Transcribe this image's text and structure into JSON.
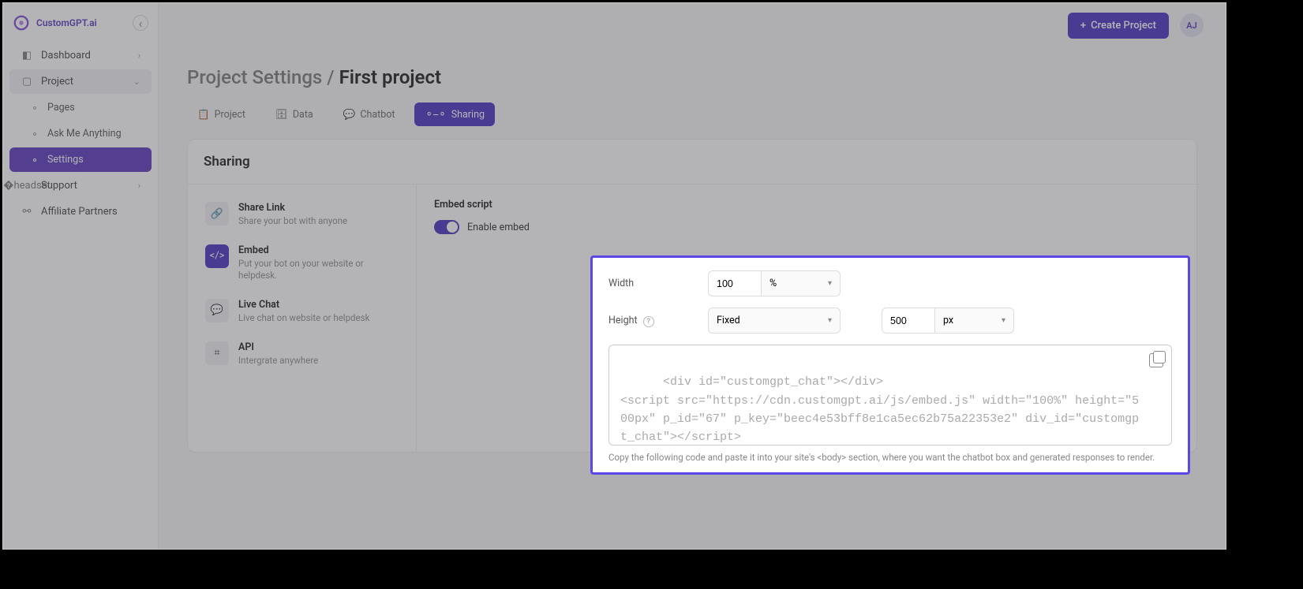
{
  "brand": "CustomGPT.ai",
  "sidebar": {
    "dashboard": "Dashboard",
    "project": "Project",
    "pages": "Pages",
    "ama": "Ask Me Anything",
    "settings": "Settings",
    "support": "Support",
    "affiliate": "Affiliate Partners"
  },
  "topbar": {
    "create": "Create Project",
    "avatar": "AJ"
  },
  "breadcrumb": {
    "parent": "Project Settings /",
    "current": "First project"
  },
  "tabs": {
    "project": "Project",
    "data": "Data",
    "chatbot": "Chatbot",
    "sharing": "Sharing"
  },
  "panel_title": "Sharing",
  "options": {
    "share_link": {
      "t": "Share Link",
      "d": "Share your bot with anyone"
    },
    "embed": {
      "t": "Embed",
      "d": "Put your bot on your website or helpdesk."
    },
    "live_chat": {
      "t": "Live Chat",
      "d": "Live chat on website or helpdesk"
    },
    "api": {
      "t": "API",
      "d": "Intergrate anywhere"
    }
  },
  "embed": {
    "title": "Embed script",
    "enable": "Enable embed",
    "width_label": "Width",
    "width_value": "100",
    "width_unit": "%",
    "height_label": "Height",
    "height_help": "?",
    "height_mode": "Fixed",
    "height_value": "500",
    "height_unit": "px",
    "code": "<div id=\"customgpt_chat\"></div>\n<script src=\"https://cdn.customgpt.ai/js/embed.js\" width=\"100%\" height=\"500px\" p_id=\"67\" p_key=\"beec4e53bff8e1ca5ec62b75a22353e2\" div_id=\"customgpt_chat\"></script>",
    "help": "Copy the following code and paste it into your site's <body> section, where you want the chatbot box and generated responses to render."
  }
}
